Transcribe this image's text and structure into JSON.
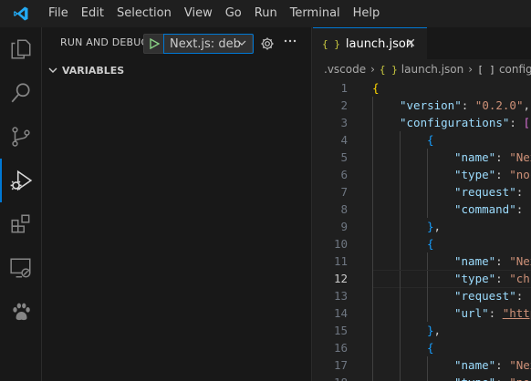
{
  "menu": {
    "items": [
      "File",
      "Edit",
      "Selection",
      "View",
      "Go",
      "Run",
      "Terminal",
      "Help"
    ]
  },
  "activity_bar": {
    "icons": [
      "explorer-icon",
      "search-icon",
      "source-control-icon",
      "run-debug-icon",
      "extensions-icon",
      "remote-explorer-icon",
      "paw-icon"
    ],
    "active": "run-debug-icon"
  },
  "sidebar": {
    "title": "RUN AND DEBUG",
    "config_value": "Next.js: deb",
    "variables_label": "VARIABLES"
  },
  "editor": {
    "tab_icon": "{ }",
    "tab_label": "launch.json",
    "close_glyph": "✕",
    "breadcrumbs": {
      "folder": ".vscode",
      "file_icon": "{ }",
      "file": "launch.json",
      "node_icon": "[ ]",
      "node": "configura"
    },
    "lines": [
      {
        "n": "1",
        "indent": 0,
        "tokens": [
          [
            "b1",
            "{"
          ]
        ]
      },
      {
        "n": "2",
        "indent": 1,
        "tokens": [
          [
            "k",
            "\"version\""
          ],
          [
            "p",
            ": "
          ],
          [
            "s",
            "\"0.2.0\""
          ],
          [
            "p",
            ","
          ]
        ]
      },
      {
        "n": "3",
        "indent": 1,
        "tokens": [
          [
            "k",
            "\"configurations\""
          ],
          [
            "p",
            ": "
          ],
          [
            "b2",
            "["
          ]
        ]
      },
      {
        "n": "4",
        "indent": 2,
        "tokens": [
          [
            "b3",
            "{"
          ]
        ]
      },
      {
        "n": "5",
        "indent": 3,
        "tokens": [
          [
            "k",
            "\"name\""
          ],
          [
            "p",
            ": "
          ],
          [
            "s",
            "\"Nex"
          ]
        ]
      },
      {
        "n": "6",
        "indent": 3,
        "tokens": [
          [
            "k",
            "\"type\""
          ],
          [
            "p",
            ": "
          ],
          [
            "s",
            "\"noc"
          ]
        ]
      },
      {
        "n": "7",
        "indent": 3,
        "tokens": [
          [
            "k",
            "\"request\""
          ],
          [
            "p",
            ": "
          ],
          [
            "s",
            "'"
          ]
        ]
      },
      {
        "n": "8",
        "indent": 3,
        "tokens": [
          [
            "k",
            "\"command\""
          ],
          [
            "p",
            ": "
          ],
          [
            "s",
            "'"
          ]
        ]
      },
      {
        "n": "9",
        "indent": 2,
        "tokens": [
          [
            "b3",
            "}"
          ],
          [
            "p",
            ","
          ]
        ]
      },
      {
        "n": "10",
        "indent": 2,
        "tokens": [
          [
            "b3",
            "{"
          ]
        ]
      },
      {
        "n": "11",
        "indent": 3,
        "tokens": [
          [
            "k",
            "\"name\""
          ],
          [
            "p",
            ": "
          ],
          [
            "s",
            "\"Nex"
          ]
        ]
      },
      {
        "n": "12",
        "indent": 3,
        "tokens": [
          [
            "k",
            "\"type\""
          ],
          [
            "p",
            ": "
          ],
          [
            "s",
            "\"chr"
          ]
        ]
      },
      {
        "n": "13",
        "indent": 3,
        "tokens": [
          [
            "k",
            "\"request\""
          ],
          [
            "p",
            ": "
          ],
          [
            "s",
            "'"
          ]
        ]
      },
      {
        "n": "14",
        "indent": 3,
        "tokens": [
          [
            "k",
            "\"url\""
          ],
          [
            "p",
            ": "
          ],
          [
            "su",
            "\"http"
          ]
        ]
      },
      {
        "n": "15",
        "indent": 2,
        "tokens": [
          [
            "b3",
            "}"
          ],
          [
            "p",
            ","
          ]
        ]
      },
      {
        "n": "16",
        "indent": 2,
        "tokens": [
          [
            "b3",
            "{"
          ]
        ]
      },
      {
        "n": "17",
        "indent": 3,
        "tokens": [
          [
            "k",
            "\"name\""
          ],
          [
            "p",
            ": "
          ],
          [
            "s",
            "\"Nex"
          ]
        ]
      },
      {
        "n": "18",
        "indent": 3,
        "tokens": [
          [
            "k",
            "\"type\""
          ],
          [
            "p",
            ": "
          ],
          [
            "s",
            "\"noc"
          ]
        ]
      }
    ],
    "current_line": "12"
  },
  "colors": {
    "accent": "#0078d4",
    "json_icon": "#cbcb41",
    "play": "#89d185"
  }
}
